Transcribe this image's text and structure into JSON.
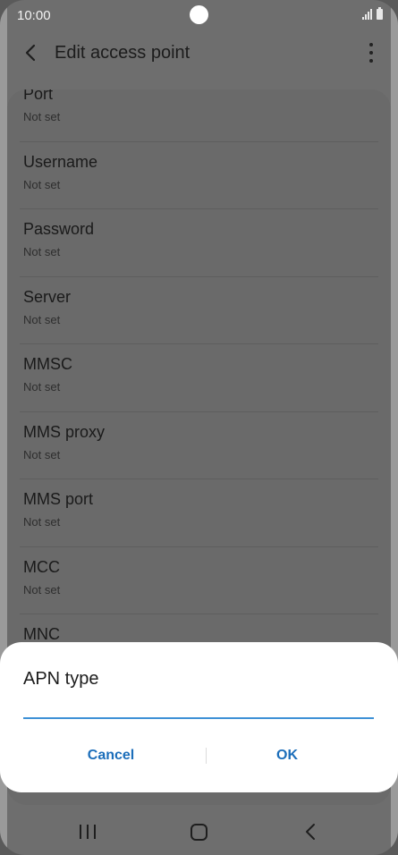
{
  "status_bar": {
    "time": "10:00"
  },
  "app_bar": {
    "title": "Edit access point"
  },
  "list": {
    "items": [
      {
        "title": "Port",
        "value": "Not set"
      },
      {
        "title": "Username",
        "value": "Not set"
      },
      {
        "title": "Password",
        "value": "Not set"
      },
      {
        "title": "Server",
        "value": "Not set"
      },
      {
        "title": "MMSC",
        "value": "Not set"
      },
      {
        "title": "MMS proxy",
        "value": "Not set"
      },
      {
        "title": "MMS port",
        "value": "Not set"
      },
      {
        "title": "MCC",
        "value": "Not set"
      },
      {
        "title": "MNC",
        "value": ""
      }
    ]
  },
  "dialog": {
    "title": "APN type",
    "input_value": "",
    "cancel_label": "Cancel",
    "ok_label": "OK"
  },
  "colors": {
    "accent": "#1c6eba",
    "input_underline": "#3e91d6",
    "dim_overlay": "#6e6e6e"
  }
}
